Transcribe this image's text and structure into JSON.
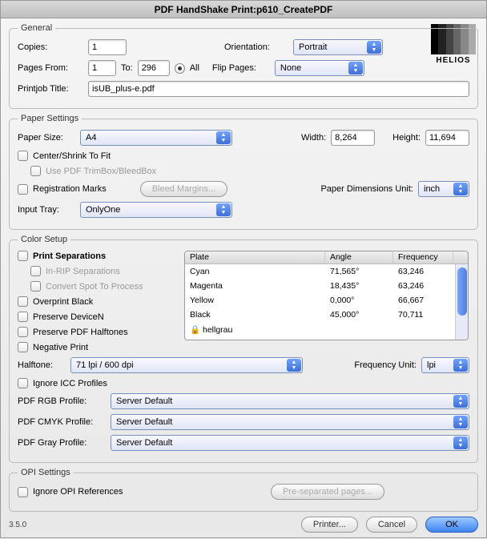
{
  "window": {
    "title": "PDF HandShake Print:p610_CreatePDF"
  },
  "logo": {
    "text": "HELIOS"
  },
  "general": {
    "legend": "General",
    "copies_lbl": "Copies:",
    "copies": "1",
    "orientation_lbl": "Orientation:",
    "orientation": "Portrait",
    "pages_from_lbl": "Pages From:",
    "pages_from": "1",
    "to_lbl": "To:",
    "to": "296",
    "all_lbl": "All",
    "flip_lbl": "Flip Pages:",
    "flip": "None",
    "printjob_lbl": "Printjob Title:",
    "printjob": "isUB_plus-e.pdf"
  },
  "paper": {
    "legend": "Paper Settings",
    "size_lbl": "Paper Size:",
    "size": "A4",
    "width_lbl": "Width:",
    "width": "8,264",
    "height_lbl": "Height:",
    "height": "11,694",
    "center_lbl": "Center/Shrink To Fit",
    "trim_lbl": "Use PDF TrimBox/BleedBox",
    "reg_lbl": "Registration Marks",
    "bleed_btn": "Bleed Margins...",
    "unit_lbl": "Paper Dimensions Unit:",
    "unit": "inch",
    "tray_lbl": "Input Tray:",
    "tray": "OnlyOne"
  },
  "color": {
    "legend": "Color Setup",
    "print_sep": "Print Separations",
    "inrip": "In-RIP Separations",
    "convert_spot": "Convert Spot To Process",
    "overprint": "Overprint Black",
    "preserve_dn": "Preserve DeviceN",
    "preserve_ht": "Preserve PDF Halftones",
    "neg": "Negative Print",
    "halftone_lbl": "Halftone:",
    "halftone": "71 lpi / 600 dpi",
    "freq_unit_lbl": "Frequency Unit:",
    "freq_unit": "lpi",
    "ignore_icc": "Ignore ICC Profiles",
    "rgb_lbl": "PDF RGB Profile:",
    "rgb": "Server Default",
    "cmyk_lbl": "PDF CMYK Profile:",
    "cmyk": "Server Default",
    "gray_lbl": "PDF Gray Profile:",
    "gray": "Server Default",
    "plate_hdr": {
      "plate": "Plate",
      "angle": "Angle",
      "freq": "Frequency"
    },
    "plates": [
      {
        "name": "Cyan",
        "angle": "71,565°",
        "freq": "63,246"
      },
      {
        "name": "Magenta",
        "angle": "18,435°",
        "freq": "63,246"
      },
      {
        "name": "Yellow",
        "angle": "0,000°",
        "freq": "66,667"
      },
      {
        "name": "Black",
        "angle": "45,000°",
        "freq": "70,711"
      },
      {
        "name": "hellgrau",
        "angle": "",
        "freq": ""
      }
    ]
  },
  "opi": {
    "legend": "OPI Settings",
    "ignore": "Ignore OPI References",
    "presep": "Pre-separated pages..."
  },
  "footer": {
    "version": "3.5.0",
    "printer": "Printer...",
    "cancel": "Cancel",
    "ok": "OK"
  }
}
